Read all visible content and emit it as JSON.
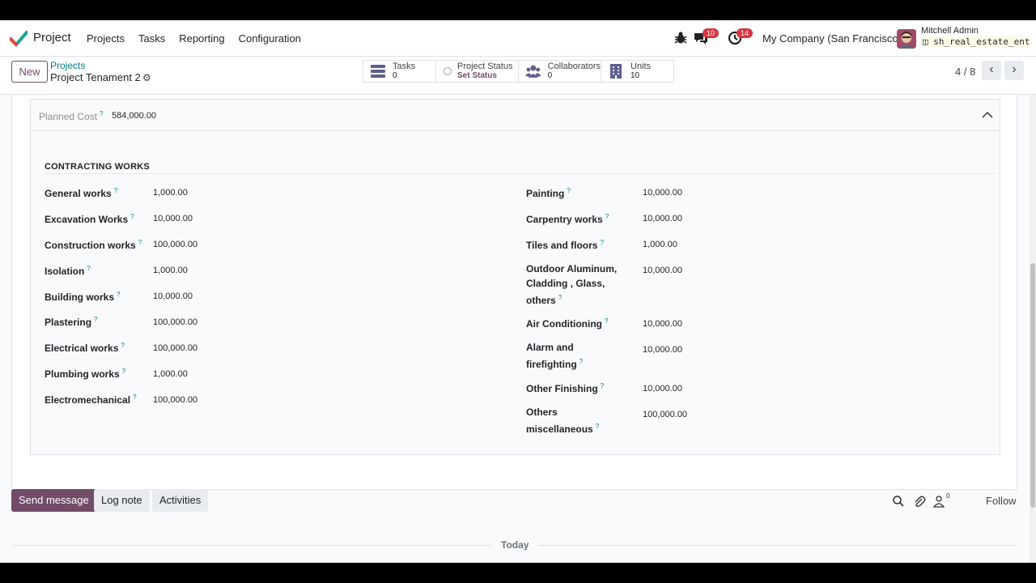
{
  "navbar": {
    "app_name": "Project",
    "menu": [
      "Projects",
      "Tasks",
      "Reporting",
      "Configuration"
    ],
    "messages_badge": "10",
    "activities_badge": "14",
    "company": "My Company (San Francisco)",
    "user_name": "Mitchell Admin",
    "database": "sh_real_estate_ent"
  },
  "control": {
    "new_label": "New",
    "breadcrumb_parent": "Projects",
    "breadcrumb_current": "Project Tenament 2",
    "smart_buttons": [
      {
        "label": "Tasks",
        "value": "0",
        "icon": "tasks-icon"
      },
      {
        "label": "Project Status",
        "value": "Set Status",
        "icon": "status-circle-icon"
      },
      {
        "label": "Collaborators",
        "value": "0",
        "icon": "users-icon"
      },
      {
        "label": "Units",
        "value": "10",
        "icon": "building-icon"
      }
    ],
    "pager": "4 / 8"
  },
  "budget": {
    "planned_cost_label": "Planned Cost",
    "planned_cost_help": "?",
    "planned_cost_value": "584,000.00",
    "section_title": "CONTRACTING WORKS",
    "left_fields": [
      {
        "label": "General works",
        "value": "1,000.00"
      },
      {
        "label": "Excavation Works",
        "value": "10,000.00"
      },
      {
        "label": "Construction works",
        "value": "100,000.00"
      },
      {
        "label": "Isolation",
        "value": "1,000.00"
      },
      {
        "label": "Building works",
        "value": "10,000.00"
      },
      {
        "label": "Plastering",
        "value": "100,000.00"
      },
      {
        "label": "Electrical works",
        "value": "100,000.00"
      },
      {
        "label": "Plumbing works",
        "value": "1,000.00"
      },
      {
        "label": "Electromechanical",
        "value": "100,000.00"
      }
    ],
    "right_fields": [
      {
        "label": "Painting",
        "value": "10,000.00"
      },
      {
        "label": "Carpentry works",
        "value": "10,000.00"
      },
      {
        "label": "Tiles and floors",
        "value": "1,000.00"
      },
      {
        "label": "Outdoor Aluminum, Cladding , Glass, others",
        "value": "10,000.00"
      },
      {
        "label": "Air Conditioning",
        "value": "10,000.00"
      },
      {
        "label": "Alarm and firefighting",
        "value": "10,000.00"
      },
      {
        "label": "Other Finishing",
        "value": "10,000.00"
      },
      {
        "label": "Others miscellaneous",
        "value": "100,000.00"
      }
    ],
    "help_marker": "?"
  },
  "chatter": {
    "send_message": "Send message",
    "log_note": "Log note",
    "activities": "Activities",
    "followers_count": "0",
    "follow": "Follow",
    "today": "Today"
  },
  "colors": {
    "brand": "#714b67",
    "link": "#017e84",
    "badge": "#d9363e"
  }
}
